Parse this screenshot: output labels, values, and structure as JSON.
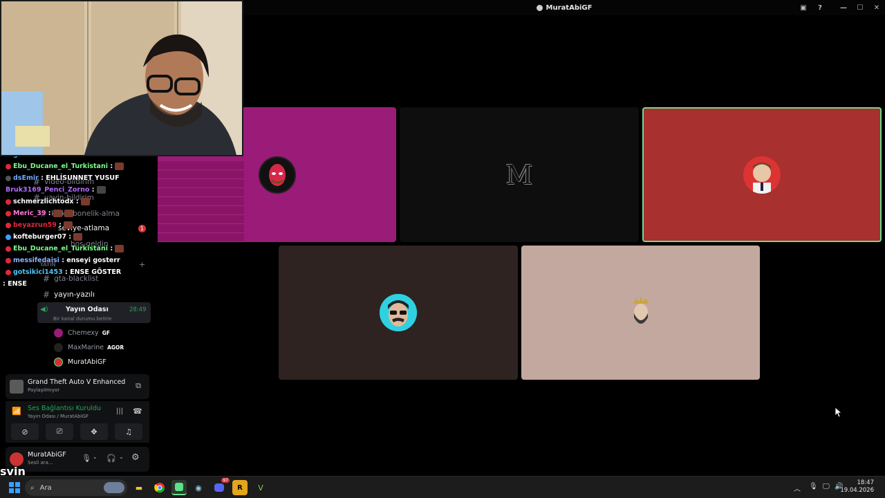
{
  "window": {
    "title": "MuratAbiGF"
  },
  "channels": {
    "video_bildirim": "video-bildirim",
    "yayin_bildirim": "yayin-bildirim",
    "kick_abonelik": "kick-abonelik-alma",
    "seviye_atlama": "seviye-atlama",
    "seviye_badge": "1",
    "hos_geldin": "hos-geldin",
    "category_yayin": "YAYIN",
    "gta_blacklist": "gta-blacklist",
    "yayin_yazili": "yayın-yazılı"
  },
  "voice_channel": {
    "name": "Yayın Odası",
    "timer": "28:49",
    "status": "Bir kanal durumu belirle",
    "users": [
      {
        "name": "Chemexy",
        "tag": "GF"
      },
      {
        "name": "MaxMarine",
        "tag": "AGOR"
      },
      {
        "name": "MuratAbiGF",
        "tag": ""
      }
    ]
  },
  "chat": [
    {
      "user": "gotsikici1453",
      "text": "ENSE GÖSTER",
      "color": "#4fc3f7"
    },
    {
      "user": "Ebu_Ducane_el_Turkistani",
      "text": ":",
      "color": "#7CFC8A"
    },
    {
      "user": "dsEmir",
      "text": "EHLİSUNNET YUSUF",
      "color": "#6fa8ff"
    },
    {
      "user": "Bruk3169_Penci_Zorno",
      "text": ":",
      "color": "#b36bff"
    },
    {
      "user": "schmerzlichtodx",
      "text": ":",
      "color": "#ffffff"
    },
    {
      "user": "Meric_39",
      "text": ":",
      "color": "#ff79d9"
    },
    {
      "user": "beyazrun59",
      "text": ":",
      "color": "#e2273b"
    },
    {
      "user": "kofteburger07",
      "text": ":",
      "color": "#ffffff"
    },
    {
      "user": "Ebu_Ducane_el_Turkistani",
      "text": ":",
      "color": "#7CFC8A"
    },
    {
      "user": "messifedaisi",
      "text": "enseyi gosterr",
      "color": "#8ab4ff"
    },
    {
      "user": "gotsikici1453",
      "text": "ENSE GÖSTER",
      "color": "#4fc3f7"
    },
    {
      "user": "",
      "text": "ENSE",
      "color": "#ffffff"
    }
  ],
  "activity": {
    "game": "Grand Theft Auto V Enhanced",
    "status": "Paylaşılmıyor"
  },
  "voice_connection": {
    "status": "Ses Bağlantısı Kuruldu",
    "path": "Yayın Odası / MuratAbiGF"
  },
  "user_panel": {
    "name": "MuratAbiGF",
    "status": "Sesli ara..."
  },
  "tiles": {
    "center_letter": "M"
  },
  "overlay": {
    "text": "svin"
  },
  "taskbar": {
    "search_placeholder": "Ara",
    "discord_badge": "97",
    "time": "18:47",
    "date": "19.04.2026"
  },
  "colors": {
    "tile_magenta": "#9b1b78",
    "tile_black": "#0e0e0e",
    "tile_red": "#a8302f",
    "tile_brown": "#2e2320",
    "tile_beige": "#c2a89e",
    "speaking_border": "#6fdc8c",
    "voice_green": "#23a55a"
  }
}
